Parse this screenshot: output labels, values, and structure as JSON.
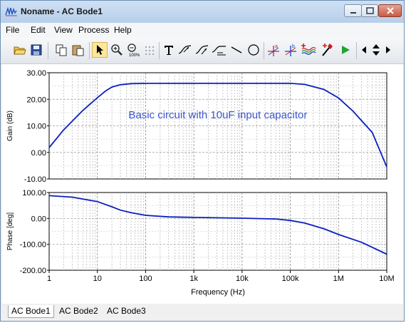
{
  "window": {
    "title": "Noname - AC Bode1"
  },
  "menu": {
    "items": [
      "File",
      "Edit",
      "View",
      "Process",
      "Help"
    ]
  },
  "toolbar": {
    "buttons": [
      {
        "name": "open-folder-icon",
        "interactable": true
      },
      {
        "name": "save-icon",
        "interactable": true
      },
      {
        "name": "copy-icon",
        "interactable": true
      },
      {
        "name": "paste-icon",
        "interactable": true
      },
      {
        "name": "pointer-icon",
        "interactable": true,
        "active": true
      },
      {
        "name": "zoom-in-icon",
        "interactable": true
      },
      {
        "name": "zoom-100-icon",
        "interactable": true
      },
      {
        "name": "grid-icon",
        "interactable": true
      },
      {
        "name": "text-tool-icon",
        "interactable": true
      },
      {
        "name": "cursor-trace-icon",
        "interactable": true
      },
      {
        "name": "cursor-trace-2-icon",
        "interactable": true
      },
      {
        "name": "label-icon",
        "interactable": true
      },
      {
        "name": "line-tool-icon",
        "interactable": true
      },
      {
        "name": "ellipse-tool-icon",
        "interactable": true
      },
      {
        "name": "cursor-a-icon",
        "interactable": true
      },
      {
        "name": "cursor-b-icon",
        "interactable": true
      },
      {
        "name": "add-trace-icon",
        "interactable": true
      },
      {
        "name": "probe-icon",
        "interactable": true
      },
      {
        "name": "run-icon",
        "interactable": true
      },
      {
        "name": "scroll-left-icon",
        "interactable": true
      },
      {
        "name": "scroll-updown-icon",
        "interactable": true
      },
      {
        "name": "scroll-right-icon",
        "interactable": true
      }
    ]
  },
  "chart_data": [
    {
      "type": "line",
      "title": "",
      "annotation": "Basic circuit with 10uF input capacitor",
      "xlabel": "",
      "ylabel": "Gain (dB)",
      "xscale": "log",
      "xlim": [
        1,
        10000000
      ],
      "ylim": [
        -10,
        30
      ],
      "yticks": [
        "30.00",
        "20.00",
        "10.00",
        "0.00",
        "-10.00"
      ],
      "grid": true,
      "line_color": "#0a1fbf",
      "annotation_color": "#3b55d0",
      "x": [
        1,
        2,
        5,
        10,
        15,
        20,
        30,
        50,
        100,
        1000,
        10000,
        100000,
        200000,
        500000,
        1000000,
        2000000,
        5000000,
        10000000
      ],
      "y": [
        1.8,
        8.5,
        15.8,
        20.6,
        23.2,
        24.6,
        25.5,
        25.9,
        26.0,
        26.0,
        26.0,
        26.0,
        25.6,
        23.7,
        20.5,
        15.5,
        7.5,
        -5.5
      ]
    },
    {
      "type": "line",
      "title": "",
      "xlabel": "Frequency (Hz)",
      "ylabel": "Phase [deg]",
      "xscale": "log",
      "xlim": [
        1,
        10000000
      ],
      "ylim": [
        -200,
        100
      ],
      "yticks": [
        "100.00",
        "0.00",
        "-100.00",
        "-200.00"
      ],
      "xticks": [
        "1",
        "10",
        "100",
        "1k",
        "10k",
        "100k",
        "1M",
        "10M"
      ],
      "grid": true,
      "line_color": "#0a1fbf",
      "x": [
        1,
        3,
        10,
        20,
        30,
        50,
        100,
        300,
        1000,
        10000,
        50000,
        100000,
        200000,
        500000,
        1000000,
        3000000,
        10000000
      ],
      "y": [
        88,
        82,
        65,
        45,
        32,
        22,
        12,
        6,
        4,
        1,
        -2,
        -8,
        -18,
        -40,
        -62,
        -92,
        -138
      ]
    }
  ],
  "tabs": [
    {
      "label": "AC Bode1",
      "active": true
    },
    {
      "label": "AC Bode2",
      "active": false
    },
    {
      "label": "AC Bode3",
      "active": false
    }
  ]
}
